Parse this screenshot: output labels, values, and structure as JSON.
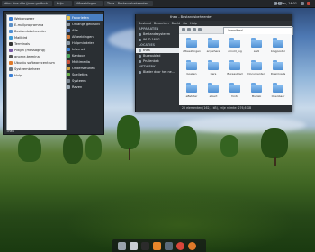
{
  "topbar": {
    "tasks": [
      "dfm: Hoe dde (jouw grafisch...",
      "Krijn",
      "Afbeeldingen",
      "Thea - Bestandsbeheerder"
    ],
    "clock": "04 Dec, 14:01"
  },
  "start_menu": {
    "left_items": [
      {
        "label": "Webbrowser",
        "icon": "globe-icon",
        "color": "#3a7fd5"
      },
      {
        "label": "E-mailprogramma",
        "icon": "mail-icon",
        "color": "#5a8fc7"
      },
      {
        "label": "Bestandsbeheerder",
        "icon": "folder-icon",
        "color": "#4e8fd3"
      },
      {
        "label": "Mailbird",
        "icon": "mail-icon",
        "color": "#3e9bd8"
      },
      {
        "label": "Terminals",
        "icon": "terminal-icon",
        "color": "#333333"
      },
      {
        "label": "Pidgin (messaging)",
        "icon": "chat-icon",
        "color": "#7a5aa6"
      },
      {
        "label": "gnome-terminal",
        "icon": "terminal-icon",
        "color": "#555555"
      },
      {
        "label": "Ubuntu softwarecentrum",
        "icon": "store-icon",
        "color": "#e07a2a"
      },
      {
        "label": "Systeembeheer",
        "icon": "gear-icon",
        "color": "#6a7580"
      },
      {
        "label": "Hulp",
        "icon": "help-icon",
        "color": "#3a7fd5"
      }
    ],
    "right_items": [
      {
        "label": "Favorieten",
        "icon": "star-icon",
        "color": "#e6c14a",
        "selected": true
      },
      {
        "label": "Onlangs gebruikt",
        "icon": "clock-icon",
        "color": "#8a95a0",
        "selected": false
      },
      {
        "label": "Alle",
        "icon": "grid-icon",
        "color": "#6b8fd0",
        "selected": false
      },
      {
        "label": "Afbeeldingen",
        "icon": "image-icon",
        "color": "#d57a3a",
        "selected": false
      },
      {
        "label": "Hulpmiddelen",
        "icon": "tools-icon",
        "color": "#8b9aa8",
        "selected": false
      },
      {
        "label": "Internet",
        "icon": "globe-icon",
        "color": "#3a7fd5",
        "selected": false
      },
      {
        "label": "Kantoor",
        "icon": "document-icon",
        "color": "#4aa35a",
        "selected": false
      },
      {
        "label": "Multimedia",
        "icon": "music-icon",
        "color": "#c9503a",
        "selected": false
      },
      {
        "label": "Ondersteunen",
        "icon": "help-icon",
        "color": "#d0a23a",
        "selected": false
      },
      {
        "label": "Spelletjes",
        "icon": "game-icon",
        "color": "#6ab04a",
        "selected": false
      },
      {
        "label": "Systeem",
        "icon": "gear-icon",
        "color": "#7a8590",
        "selected": false
      },
      {
        "label": "Raven",
        "icon": "bird-icon",
        "color": "#9aa6b2",
        "selected": false
      }
    ],
    "footer": "Thea"
  },
  "file_manager": {
    "title": "thea - Bestandsbeheerder",
    "menu": [
      "Bestand",
      "Bewerken",
      "Beeld",
      "Ga",
      "Hulp"
    ],
    "sidebar": {
      "sections": [
        {
          "heading": "APPARATEN",
          "items": [
            "Bestandssysteem",
            "WUD 160G"
          ]
        },
        {
          "heading": "LOCATIES",
          "items": [
            "thea",
            "Bureaublad",
            "Prullenbak"
          ]
        },
        {
          "heading": "NETWERK",
          "items": [
            "Blader door het ne..."
          ]
        }
      ],
      "active": "thea"
    },
    "path": "/home/thea/",
    "folders": [
      [
        "Afbeeldingen",
        "anywhere",
        "arnold_log",
        "audi",
        "blogposter"
      ],
      [
        "boeken",
        "Bers",
        "Bureaublad",
        "Documenten",
        "Downloads"
      ],
      [
        "eBstater",
        "elbert",
        "fonts",
        "Muziek",
        "Openbaar"
      ]
    ],
    "status": "25 elementen (162,1 kB), vrije ruimte: 276,6 GB"
  },
  "dock": {
    "items": [
      {
        "icon": "trash-icon",
        "color": "#9aa3ab"
      },
      {
        "icon": "folder-icon",
        "color": "#c9cdd2"
      },
      {
        "icon": "terminal-icon",
        "color": "#2b2b2b"
      },
      {
        "icon": "vlc-icon",
        "color": "#e8872a"
      },
      {
        "icon": "media-player-icon",
        "color": "#5a6b7a"
      },
      {
        "icon": "chrome-icon",
        "color": "#d9463b"
      },
      {
        "icon": "firefox-icon",
        "color": "#e07a2a"
      }
    ]
  }
}
